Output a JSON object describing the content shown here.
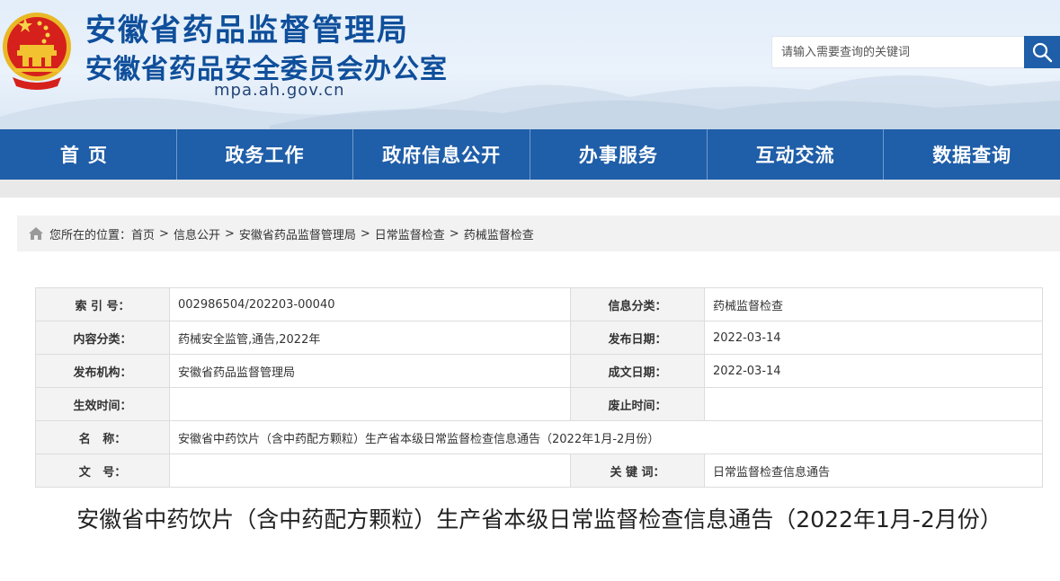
{
  "header": {
    "title_line1": "安徽省药品监督管理局",
    "title_line2": "安徽省药品安全委员会办公室",
    "domain": "mpa.ah.gov.cn",
    "emblem_icon": "national-emblem-icon",
    "search": {
      "placeholder": "请输入需要查询的关键词",
      "button_icon": "search-icon"
    }
  },
  "colors": {
    "primary": "#1f5ea8",
    "title": "#0f4f9b",
    "emblem_red": "#d6201c",
    "emblem_gold": "#f2c230"
  },
  "nav": {
    "items": [
      "首页",
      "政务工作",
      "政府信息公开",
      "办事服务",
      "互动交流",
      "数据查询"
    ]
  },
  "breadcrumb": {
    "icon": "home-icon",
    "prefix": "您所在的位置：",
    "items": [
      "首页",
      "信息公开",
      "安徽省药品监督管理局",
      "日常监督检查",
      "药械监督检查"
    ]
  },
  "info": {
    "index_label": "索 引 号：",
    "index_value": "002986504/202203-00040",
    "category_label": "信息分类：",
    "category_value": "药械监督检查",
    "content_label": "内容分类：",
    "content_value": "药械安全监管,通告,2022年",
    "pubdate_label": "发布日期：",
    "pubdate_value": "2022-03-14",
    "org_label": "发布机构：",
    "org_value": "安徽省药品监督管理局",
    "writedate_label": "成文日期：",
    "writedate_value": "2022-03-14",
    "effective_label": "生效时间：",
    "effective_value": "",
    "expire_label": "废止时间：",
    "expire_value": "",
    "name_label": "名   称：",
    "name_value": "安徽省中药饮片（含中药配方颗粒）生产省本级日常监督检查信息通告（2022年1月-2月份）",
    "docno_label": "文   号：",
    "docno_value": "",
    "keywords_label": "关 键 词：",
    "keywords_value": "日常监督检查信息通告"
  },
  "article": {
    "title": "安徽省中药饮片（含中药配方颗粒）生产省本级日常监督检查信息通告（2022年1月-2月份）"
  }
}
